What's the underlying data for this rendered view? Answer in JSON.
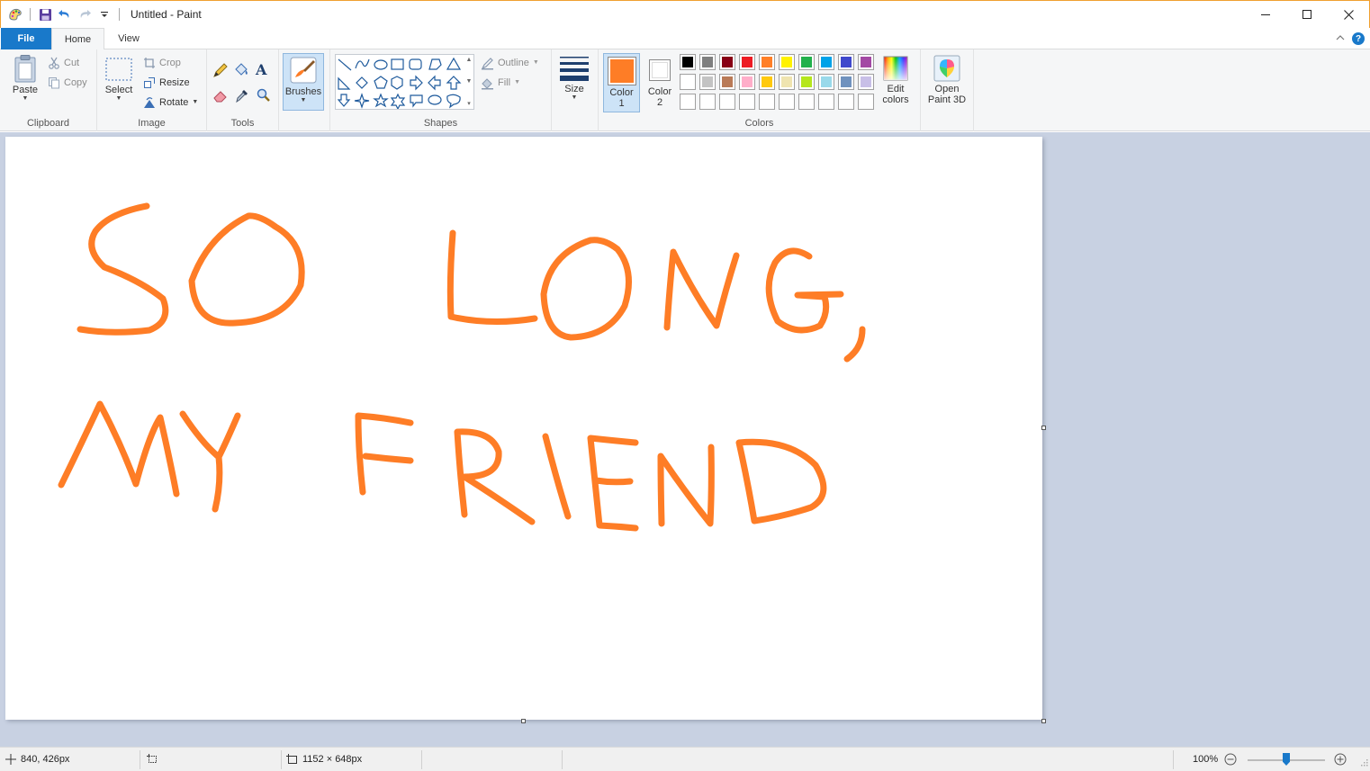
{
  "window": {
    "title": "Untitled - Paint"
  },
  "tabs": {
    "file": "File",
    "home": "Home",
    "view": "View"
  },
  "clipboard": {
    "paste": "Paste",
    "cut": "Cut",
    "copy": "Copy",
    "group_label": "Clipboard"
  },
  "image": {
    "select": "Select",
    "crop": "Crop",
    "resize": "Resize",
    "rotate": "Rotate",
    "group_label": "Image"
  },
  "tools": {
    "group_label": "Tools"
  },
  "brushes": {
    "label": "Brushes"
  },
  "shapes": {
    "outline": "Outline",
    "fill": "Fill",
    "group_label": "Shapes"
  },
  "size": {
    "label": "Size"
  },
  "colors": {
    "color1_label_a": "Color",
    "color1_label_b": "1",
    "color2_label_a": "Color",
    "color2_label_b": "2",
    "edit_a": "Edit",
    "edit_b": "colors",
    "group_label": "Colors",
    "color1": "#fe7d26",
    "color2": "#ffffff",
    "palette_row1": [
      "#000000",
      "#7f7f7f",
      "#880015",
      "#ed1c24",
      "#ff7f27",
      "#fff200",
      "#22b14c",
      "#00a2e8",
      "#3f48cc",
      "#a349a4"
    ],
    "palette_row2": [
      "#ffffff",
      "#c3c3c3",
      "#b97a57",
      "#ffaec9",
      "#ffc90e",
      "#efe4b0",
      "#b5e61d",
      "#99d9ea",
      "#7092be",
      "#c8bfe7"
    ]
  },
  "paint3d": {
    "label_a": "Open",
    "label_b": "Paint 3D"
  },
  "canvas_text": {
    "line1": "SO LONG,",
    "line2": "MY FRIEND",
    "stroke_color": "#fe7d26"
  },
  "status": {
    "cursor_pos": "840, 426px",
    "image_size": "1152 × 648px",
    "zoom": "100%",
    "zoom_level_percent": 100
  }
}
